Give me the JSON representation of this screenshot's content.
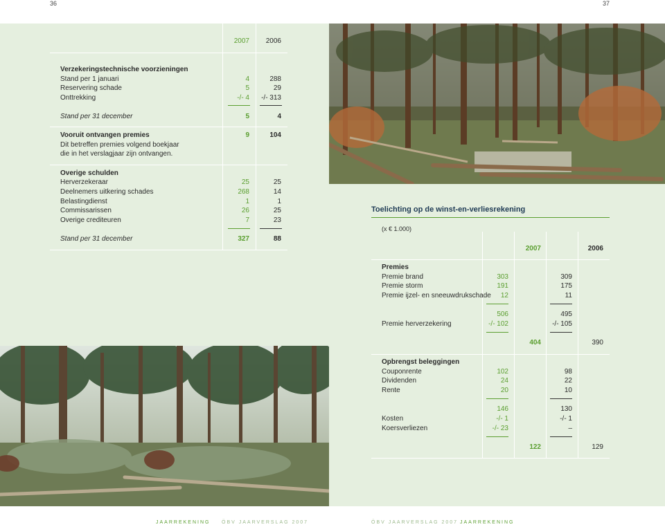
{
  "page_numbers": {
    "left": "36",
    "right": "37"
  },
  "left_table": {
    "years": [
      "2007",
      "2006"
    ],
    "sections": [
      {
        "title": "Verzekeringstechnische voorzieningen",
        "rows": [
          {
            "label": "Stand per 1 januari",
            "v2007": "4",
            "v2006": "288"
          },
          {
            "label": "Reservering schade",
            "v2007": "5",
            "v2006": "29"
          },
          {
            "label": "Onttrekking",
            "v2007": "-/- 4",
            "v2006": "-/- 313"
          }
        ]
      },
      {
        "total": {
          "label": "Stand per 31 december",
          "v2007": "5",
          "v2006": "4"
        }
      },
      {
        "title": "Vooruit ontvangen premies",
        "v2007": "9",
        "v2006": "104",
        "note_lines": [
          "Dit betreffen premies volgend boekjaar",
          "die in het verslagjaar zijn ontvangen."
        ]
      },
      {
        "title": "Overige schulden",
        "rows": [
          {
            "label": "Herverzekeraar",
            "v2007": "25",
            "v2006": "25"
          },
          {
            "label": "Deelnemers uitkering schades",
            "v2007": "268",
            "v2006": "14"
          },
          {
            "label": "Belastingdienst",
            "v2007": "1",
            "v2006": "1"
          },
          {
            "label": "Commissarissen",
            "v2007": "26",
            "v2006": "25"
          },
          {
            "label": "Overige crediteuren",
            "v2007": "7",
            "v2006": "23"
          }
        ]
      },
      {
        "total": {
          "label": "Stand per 31 december",
          "v2007": "327",
          "v2006": "88"
        }
      }
    ]
  },
  "right_table": {
    "title": "Toelichting op de winst-en-verliesrekening",
    "unit": "(x € 1.000)",
    "years": [
      "2007",
      "2006"
    ],
    "premies": {
      "title": "Premies",
      "rows": [
        {
          "label": "Premie brand",
          "a2007": "303",
          "a2006": "309"
        },
        {
          "label": "Premie storm",
          "a2007": "191",
          "a2006": "175"
        },
        {
          "label": "Premie ijzel- en sneeuwdrukschade",
          "a2007": "12",
          "a2006": "11"
        }
      ],
      "subtotal": {
        "a2007": "506",
        "a2006": "495"
      },
      "herverzekering": {
        "label": "Premie herverzekering",
        "a2007": "-/- 102",
        "a2006": "-/- 105"
      },
      "total": {
        "b2007": "404",
        "b2006": "390"
      }
    },
    "beleggingen": {
      "title": "Opbrengst beleggingen",
      "rows": [
        {
          "label": "Couponrente",
          "a2007": "102",
          "a2006": "98"
        },
        {
          "label": "Dividenden",
          "a2007": "24",
          "a2006": "22"
        },
        {
          "label": "Rente",
          "a2007": "20",
          "a2006": "10"
        }
      ],
      "subtotal": {
        "a2007": "146",
        "a2006": "130"
      },
      "kosten": {
        "label": "Kosten",
        "a2007": "-/- 1",
        "a2006": "-/- 1"
      },
      "koers": {
        "label": "Koersverliezen",
        "a2007": "-/- 23",
        "a2006": "–"
      },
      "total": {
        "b2007": "122",
        "b2006": "129"
      }
    }
  },
  "footer": {
    "left_section": "JAARREKENING",
    "left_report": "ÖBV JAARVERSLAG 2007",
    "right_report": "ÖBV JAARVERSLAG 2007",
    "right_section": "JAARREKENING"
  },
  "colors": {
    "green": "#5a9e2f",
    "panel": "#e5efdf",
    "navy": "#1f3b55"
  }
}
